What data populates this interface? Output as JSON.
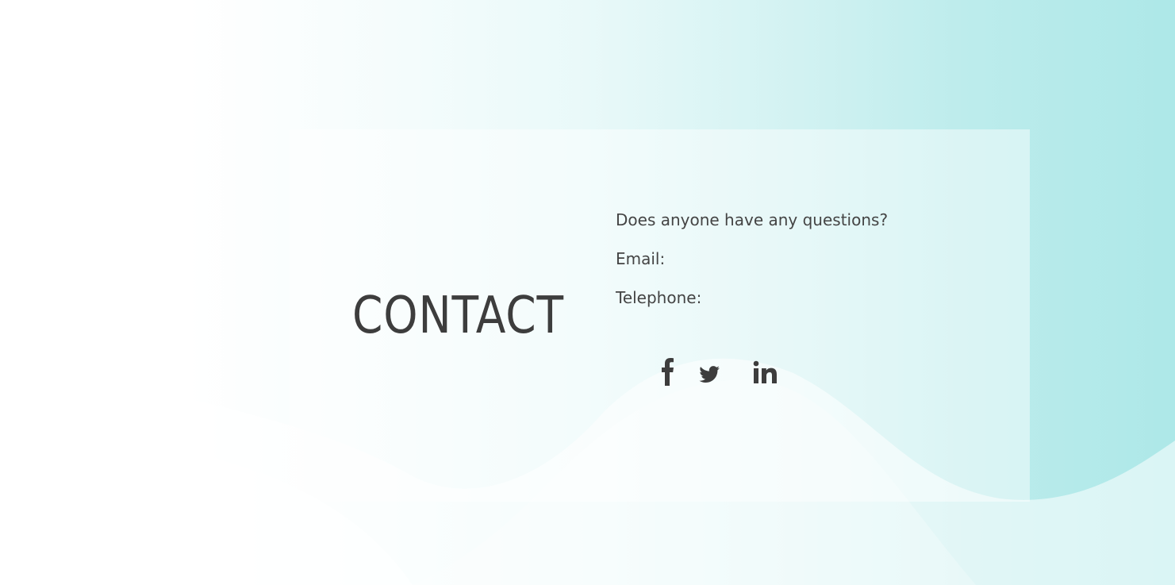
{
  "contact": {
    "title": "CONTACT",
    "question": "Does anyone have any questions?",
    "email_label": "Email:",
    "telephone_label": "Telephone:"
  },
  "social": [
    {
      "icon": "facebook-icon"
    },
    {
      "icon": "twitter-icon"
    },
    {
      "icon": "linkedin-icon"
    }
  ],
  "colors": {
    "text": "#444444",
    "title": "#3d3d3d",
    "accent": "#ade8e8",
    "background": "#ffffff"
  }
}
